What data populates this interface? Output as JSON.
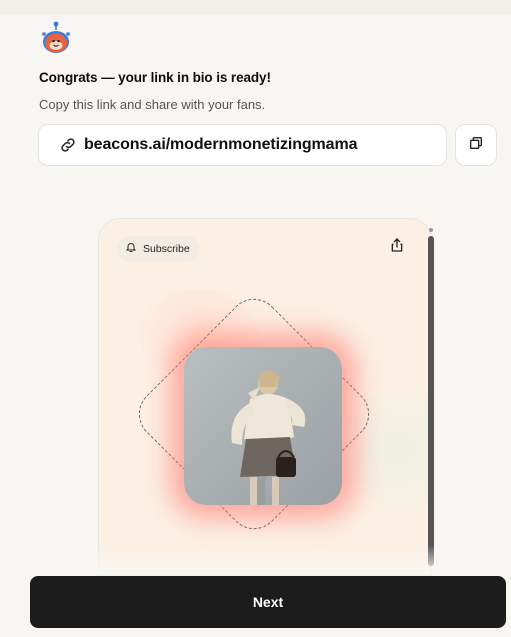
{
  "header": {
    "headline": "Congrats — your link in bio is ready!",
    "subline": "Copy this link and share with your fans."
  },
  "link": {
    "url": "beacons.ai/modernmonetizingmama",
    "link_icon": "link-icon",
    "copy_icon": "copy-icon"
  },
  "preview": {
    "subscribe_label": "Subscribe",
    "subscribe_icon": "bell-icon",
    "share_icon": "share-icon"
  },
  "footer": {
    "next_label": "Next"
  },
  "colors": {
    "background": "#f8f6f2",
    "card_bg": "#fcf0e4",
    "button_bg": "#1c1c1c",
    "glow": "#ff6e64",
    "logo_orange": "#e8643c"
  }
}
